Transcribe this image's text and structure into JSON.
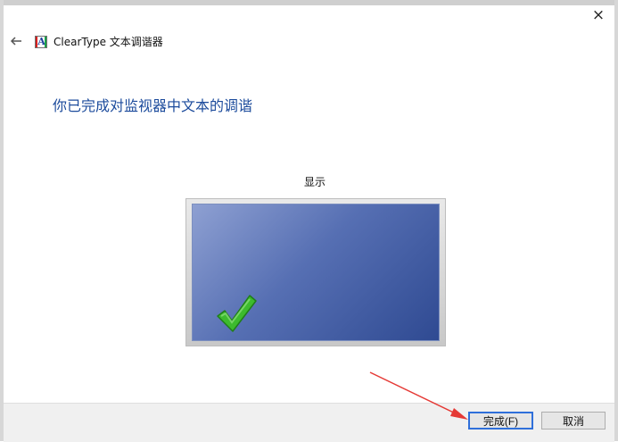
{
  "window": {
    "close_glyph": "×",
    "app_title": "ClearType 文本调谐器"
  },
  "main": {
    "heading": "你已完成对监视器中文本的调谐",
    "display_label": "显示",
    "icons": {
      "back": "arrow-left-icon",
      "app": "cleartype-icon",
      "checkmark": "checkmark-icon"
    }
  },
  "footer": {
    "finish_label": "完成(F)",
    "cancel_label": "取消"
  },
  "colors": {
    "heading": "#1c4b9c",
    "screen_top": "#8ea0d2",
    "screen_bottom": "#2f4a92",
    "check": "#3dbb2e",
    "annotation_arrow": "#e53935",
    "focus_border": "#2f6fda"
  }
}
